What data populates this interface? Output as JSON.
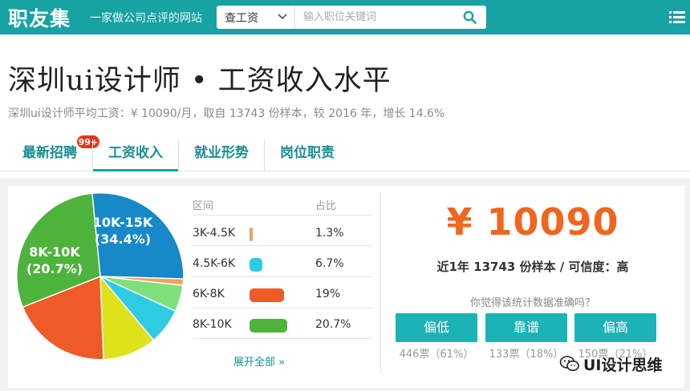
{
  "header": {
    "logo": "职友集",
    "slogan": "一家做公司点评的网站",
    "search": {
      "type_label": "查工资",
      "placeholder": "输入职位关键词"
    }
  },
  "page": {
    "title": "深圳ui设计师 • 工资收入水平",
    "subtitle": "深圳ui设计师平均工资：¥ 10090/月，取自 13743 份样本，较 2016 年，增长 14.6%"
  },
  "tabs": [
    {
      "label": "最新招聘",
      "badge": "99+"
    },
    {
      "label": "工资收入",
      "active": true
    },
    {
      "label": "就业形势"
    },
    {
      "label": "岗位职责"
    }
  ],
  "table": {
    "headers": [
      "区间",
      "占比"
    ],
    "rows": [
      {
        "range": "3K-4.5K",
        "percent": "1.3%",
        "color": "#f0a15e"
      },
      {
        "range": "4.5K-6K",
        "percent": "6.7%",
        "color": "#2ecbe3"
      },
      {
        "range": "6K-8K",
        "percent": "19%",
        "color": "#ee5a28"
      },
      {
        "range": "8K-10K",
        "percent": "20.7%",
        "color": "#4db33d"
      }
    ],
    "expand_label": "展开全部 »"
  },
  "pie": {
    "label_a_range": "10K-15K",
    "label_a_pct": "(34.4%)",
    "label_b_range": "8K-10K",
    "label_b_pct": "(20.7%)"
  },
  "summary": {
    "salary": "¥ 10090",
    "sample_line": "近1年 13743 份样本 / 可信度：高",
    "question": "你觉得该统计数据准确吗？"
  },
  "votes": [
    {
      "label": "偏低",
      "count": "446票（61%）"
    },
    {
      "label": "靠谱",
      "count": "133票（18%）"
    },
    {
      "label": "偏高",
      "count": "150票（21%）"
    }
  ],
  "watermark": {
    "text": "UI设计思维"
  },
  "colors": {
    "brand": "#17a2a3",
    "accent_orange": "#f0661e",
    "button": "#1bb3b5",
    "badge": "#e8341c"
  }
}
